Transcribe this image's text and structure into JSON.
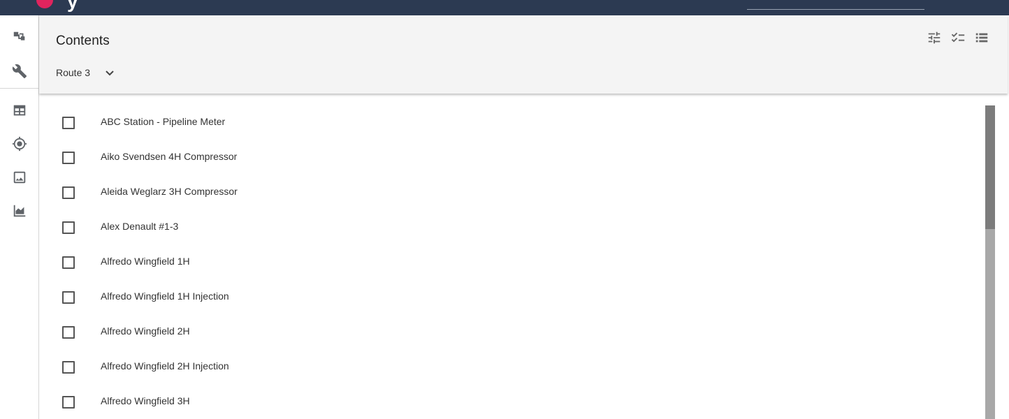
{
  "colors": {
    "topbar": "#2c3a52",
    "brand": "#e0245e",
    "header_bg": "#f4f4f4",
    "icon": "#5f6368"
  },
  "topbar": {
    "brand_text": "y"
  },
  "sidebar": {
    "items": [
      {
        "name": "tree-icon"
      },
      {
        "name": "wrench-icon"
      },
      {
        "name": "table-icon"
      },
      {
        "name": "location-icon"
      },
      {
        "name": "image-icon"
      },
      {
        "name": "area-chart-icon"
      }
    ]
  },
  "header": {
    "title": "Contents",
    "route": "Route 3",
    "icons": [
      "tune-icon",
      "checklist-icon",
      "list-icon"
    ]
  },
  "list": {
    "items": [
      {
        "label": "ABC Station - Pipeline Meter",
        "checked": false
      },
      {
        "label": "Aiko Svendsen 4H Compressor",
        "checked": false
      },
      {
        "label": "Aleida Weglarz 3H Compressor",
        "checked": false
      },
      {
        "label": "Alex Denault #1-3",
        "checked": false
      },
      {
        "label": "Alfredo Wingfield 1H",
        "checked": false
      },
      {
        "label": "Alfredo Wingfield 1H Injection",
        "checked": false
      },
      {
        "label": "Alfredo Wingfield 2H",
        "checked": false
      },
      {
        "label": "Alfredo Wingfield 2H Injection",
        "checked": false
      },
      {
        "label": "Alfredo Wingfield 3H",
        "checked": false
      }
    ]
  }
}
